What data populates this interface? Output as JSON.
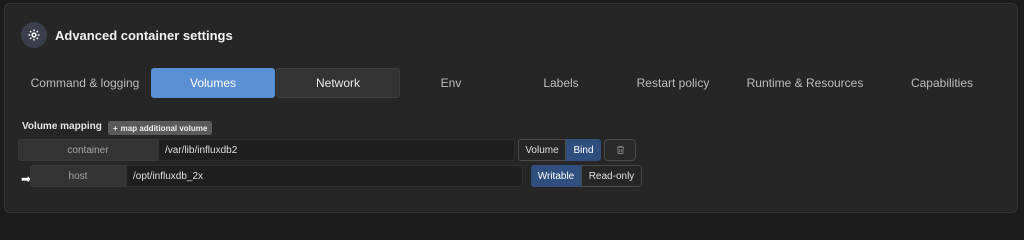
{
  "header": {
    "title": "Advanced container settings",
    "icon": "gear-icon"
  },
  "tabs": [
    {
      "label": "Command & logging"
    },
    {
      "label": "Volumes"
    },
    {
      "label": "Network"
    },
    {
      "label": "Env"
    },
    {
      "label": "Labels"
    },
    {
      "label": "Restart policy"
    },
    {
      "label": "Runtime & Resources"
    },
    {
      "label": "Capabilities"
    }
  ],
  "volumes": {
    "section_label": "Volume mapping",
    "add_button": {
      "icon": "+",
      "label": "map additional volume"
    },
    "mapping": {
      "container_label": "container",
      "container_value": "/var/lib/influxdb2",
      "type_options": [
        "Volume",
        "Bind"
      ],
      "type_selected": "Bind",
      "host_label": "host",
      "host_value": "/opt/influxdb_2x",
      "arrow_glyph": "➡",
      "mode_options": [
        "Writable",
        "Read-only"
      ],
      "mode_selected": "Writable"
    }
  },
  "colors": {
    "accent": "#5b8fd4",
    "segment_active": "#2f4f7f",
    "delete": "#c0392b"
  }
}
